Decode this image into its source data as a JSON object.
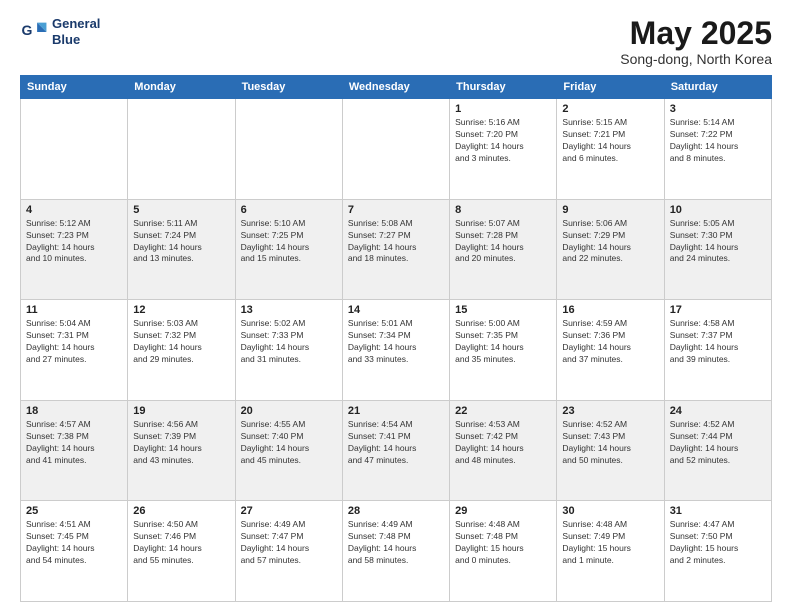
{
  "logo": {
    "line1": "General",
    "line2": "Blue"
  },
  "title": "May 2025",
  "location": "Song-dong, North Korea",
  "days_header": [
    "Sunday",
    "Monday",
    "Tuesday",
    "Wednesday",
    "Thursday",
    "Friday",
    "Saturday"
  ],
  "weeks": [
    [
      {
        "day": "",
        "info": ""
      },
      {
        "day": "",
        "info": ""
      },
      {
        "day": "",
        "info": ""
      },
      {
        "day": "",
        "info": ""
      },
      {
        "day": "1",
        "info": "Sunrise: 5:16 AM\nSunset: 7:20 PM\nDaylight: 14 hours\nand 3 minutes."
      },
      {
        "day": "2",
        "info": "Sunrise: 5:15 AM\nSunset: 7:21 PM\nDaylight: 14 hours\nand 6 minutes."
      },
      {
        "day": "3",
        "info": "Sunrise: 5:14 AM\nSunset: 7:22 PM\nDaylight: 14 hours\nand 8 minutes."
      }
    ],
    [
      {
        "day": "4",
        "info": "Sunrise: 5:12 AM\nSunset: 7:23 PM\nDaylight: 14 hours\nand 10 minutes."
      },
      {
        "day": "5",
        "info": "Sunrise: 5:11 AM\nSunset: 7:24 PM\nDaylight: 14 hours\nand 13 minutes."
      },
      {
        "day": "6",
        "info": "Sunrise: 5:10 AM\nSunset: 7:25 PM\nDaylight: 14 hours\nand 15 minutes."
      },
      {
        "day": "7",
        "info": "Sunrise: 5:08 AM\nSunset: 7:27 PM\nDaylight: 14 hours\nand 18 minutes."
      },
      {
        "day": "8",
        "info": "Sunrise: 5:07 AM\nSunset: 7:28 PM\nDaylight: 14 hours\nand 20 minutes."
      },
      {
        "day": "9",
        "info": "Sunrise: 5:06 AM\nSunset: 7:29 PM\nDaylight: 14 hours\nand 22 minutes."
      },
      {
        "day": "10",
        "info": "Sunrise: 5:05 AM\nSunset: 7:30 PM\nDaylight: 14 hours\nand 24 minutes."
      }
    ],
    [
      {
        "day": "11",
        "info": "Sunrise: 5:04 AM\nSunset: 7:31 PM\nDaylight: 14 hours\nand 27 minutes."
      },
      {
        "day": "12",
        "info": "Sunrise: 5:03 AM\nSunset: 7:32 PM\nDaylight: 14 hours\nand 29 minutes."
      },
      {
        "day": "13",
        "info": "Sunrise: 5:02 AM\nSunset: 7:33 PM\nDaylight: 14 hours\nand 31 minutes."
      },
      {
        "day": "14",
        "info": "Sunrise: 5:01 AM\nSunset: 7:34 PM\nDaylight: 14 hours\nand 33 minutes."
      },
      {
        "day": "15",
        "info": "Sunrise: 5:00 AM\nSunset: 7:35 PM\nDaylight: 14 hours\nand 35 minutes."
      },
      {
        "day": "16",
        "info": "Sunrise: 4:59 AM\nSunset: 7:36 PM\nDaylight: 14 hours\nand 37 minutes."
      },
      {
        "day": "17",
        "info": "Sunrise: 4:58 AM\nSunset: 7:37 PM\nDaylight: 14 hours\nand 39 minutes."
      }
    ],
    [
      {
        "day": "18",
        "info": "Sunrise: 4:57 AM\nSunset: 7:38 PM\nDaylight: 14 hours\nand 41 minutes."
      },
      {
        "day": "19",
        "info": "Sunrise: 4:56 AM\nSunset: 7:39 PM\nDaylight: 14 hours\nand 43 minutes."
      },
      {
        "day": "20",
        "info": "Sunrise: 4:55 AM\nSunset: 7:40 PM\nDaylight: 14 hours\nand 45 minutes."
      },
      {
        "day": "21",
        "info": "Sunrise: 4:54 AM\nSunset: 7:41 PM\nDaylight: 14 hours\nand 47 minutes."
      },
      {
        "day": "22",
        "info": "Sunrise: 4:53 AM\nSunset: 7:42 PM\nDaylight: 14 hours\nand 48 minutes."
      },
      {
        "day": "23",
        "info": "Sunrise: 4:52 AM\nSunset: 7:43 PM\nDaylight: 14 hours\nand 50 minutes."
      },
      {
        "day": "24",
        "info": "Sunrise: 4:52 AM\nSunset: 7:44 PM\nDaylight: 14 hours\nand 52 minutes."
      }
    ],
    [
      {
        "day": "25",
        "info": "Sunrise: 4:51 AM\nSunset: 7:45 PM\nDaylight: 14 hours\nand 54 minutes."
      },
      {
        "day": "26",
        "info": "Sunrise: 4:50 AM\nSunset: 7:46 PM\nDaylight: 14 hours\nand 55 minutes."
      },
      {
        "day": "27",
        "info": "Sunrise: 4:49 AM\nSunset: 7:47 PM\nDaylight: 14 hours\nand 57 minutes."
      },
      {
        "day": "28",
        "info": "Sunrise: 4:49 AM\nSunset: 7:48 PM\nDaylight: 14 hours\nand 58 minutes."
      },
      {
        "day": "29",
        "info": "Sunrise: 4:48 AM\nSunset: 7:48 PM\nDaylight: 15 hours\nand 0 minutes."
      },
      {
        "day": "30",
        "info": "Sunrise: 4:48 AM\nSunset: 7:49 PM\nDaylight: 15 hours\nand 1 minute."
      },
      {
        "day": "31",
        "info": "Sunrise: 4:47 AM\nSunset: 7:50 PM\nDaylight: 15 hours\nand 2 minutes."
      }
    ]
  ]
}
